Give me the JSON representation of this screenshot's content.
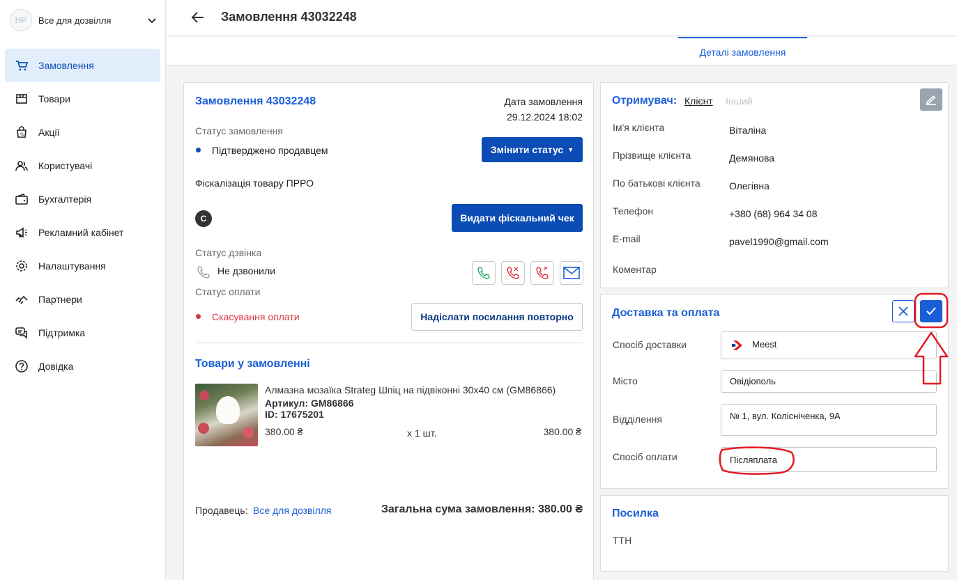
{
  "sidebar": {
    "shop_initials": "HP",
    "shop_name": "Все для дозвілля",
    "items": [
      {
        "label": "Замовлення",
        "icon": "cart-icon",
        "active": true
      },
      {
        "label": "Товари",
        "icon": "box-icon"
      },
      {
        "label": "Акції",
        "icon": "promo-bag-icon"
      },
      {
        "label": "Користувачі",
        "icon": "users-icon"
      },
      {
        "label": "Бухгалтерія",
        "icon": "wallet-icon"
      },
      {
        "label": "Рекламний кабінет",
        "icon": "megaphone-icon"
      },
      {
        "label": "Налаштування",
        "icon": "gear-icon"
      },
      {
        "label": "Партнери",
        "icon": "handshake-icon"
      },
      {
        "label": "Підтримка",
        "icon": "chat-icon"
      },
      {
        "label": "Довідка",
        "icon": "help-icon"
      }
    ]
  },
  "header": {
    "title": "Замовлення 43032248"
  },
  "tabs": [
    {
      "label": "Деталі замовлення",
      "active": true
    }
  ],
  "order": {
    "title": "Замовлення 43032248",
    "date_label": "Дата замовлення",
    "date_value": "29.12.2024 18:02",
    "status_label": "Статус замовлення",
    "status_value": "Підтверджено продавцем",
    "change_status_button": "Змінити статус",
    "fiscal_label": "Фіскалізація товару ПРРО",
    "fiscal_badge": "C",
    "fiscal_button": "Видати фіскальний чек",
    "call_status_label": "Статус дзвінка",
    "call_status_value": "Не дзвонили",
    "payment_status_label": "Статус оплати",
    "payment_status_value": "Скасування оплати",
    "resend_button": "Надіслати посилання повторно",
    "items_title": "Товари у замовленні",
    "items": [
      {
        "name": "Алмазна мозаїка Strateg Шпіц на підвіконні 30х40 см (GM86866)",
        "article": "Артикул: GM86866",
        "id": "ID: 17675201",
        "price": "380.00 ₴",
        "qty": "x 1 шт.",
        "sum": "380.00 ₴"
      }
    ],
    "seller_label": "Продавець:",
    "seller_name": "Все для дозвілля",
    "total_label": "Загальна сума замовлення: 380.00 ₴"
  },
  "recipient": {
    "title": "Отримувач:",
    "option_client": "Клієнт",
    "option_other": "Інший",
    "fields": [
      {
        "label": "Ім'я клієнта",
        "value": "Віталіна"
      },
      {
        "label": "Прізвище клієнта",
        "value": "Демянова"
      },
      {
        "label": "По батькові клієнта",
        "value": "Олегівна"
      },
      {
        "label": "Телефон",
        "value": "+380 (68) 964 34 08"
      },
      {
        "label": "E-mail",
        "value": "pavel1990@gmail.com"
      },
      {
        "label": "Коментар",
        "value": ""
      }
    ]
  },
  "delivery": {
    "title": "Доставка та оплата",
    "method_label": "Спосіб доставки",
    "method_value": "Meest",
    "city_label": "Місто",
    "city_value": "Овідіополь",
    "branch_label": "Відділення",
    "branch_value": "№ 1, вул. Колісніченка, 9А",
    "payment_label": "Спосіб оплати",
    "payment_value": "Післяплата"
  },
  "parcel": {
    "title": "Посилка",
    "ttn_label": "ТТН"
  },
  "colors": {
    "accent": "#1a5fd6",
    "primary_button": "#0c4cb5",
    "error": "#d9363e",
    "annotation": "#e31b23"
  }
}
